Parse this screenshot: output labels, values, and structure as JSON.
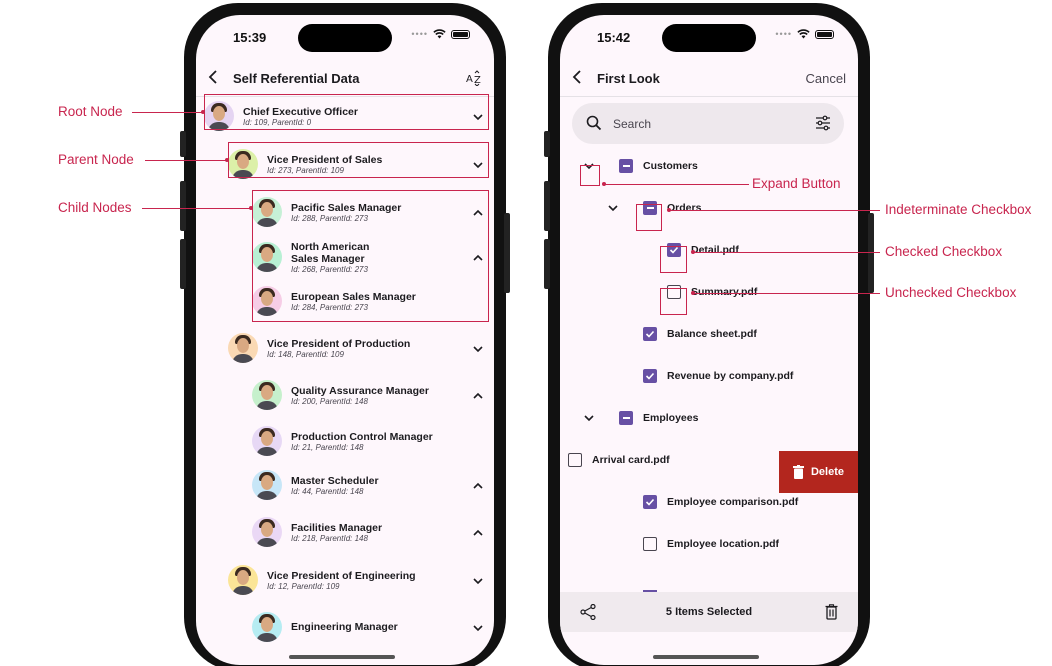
{
  "annotations": {
    "left": [
      "Root Node",
      "Parent Node",
      "Child Nodes"
    ],
    "right": [
      "Expand Button",
      "Indeterminate Checkbox",
      "Checked Checkbox",
      "Unchecked Checkbox"
    ],
    "accent": "#c8254e"
  },
  "left_phone": {
    "status_time": "15:39",
    "title": "Self Referential Data",
    "sort_icon_label": "AZ",
    "nodes": [
      {
        "title": "Chief Executive Officer",
        "sub": "Id: 109, ParentId: 0",
        "level": 0,
        "expander": "chevron-down",
        "avatar_bg": "#e5d4f2"
      },
      {
        "title": "Vice President of Sales",
        "sub": "Id: 273, ParentId: 109",
        "level": 1,
        "expander": "chevron-down",
        "avatar_bg": "#dcf0a8"
      },
      {
        "title": "Pacific Sales Manager",
        "sub": "Id: 288, ParentId: 273",
        "level": 2,
        "expander": "chevron-up",
        "avatar_bg": "#c6f0d6"
      },
      {
        "title": "North American Sales Manager",
        "title_line1": "North American",
        "title_line2": "Sales Manager",
        "sub": "Id: 268, ParentId: 273",
        "level": 2,
        "expander": "chevron-up",
        "avatar_bg": "#b8f0d4"
      },
      {
        "title": "European Sales Manager",
        "sub": "Id: 284, ParentId: 273",
        "level": 2,
        "expander": "none",
        "avatar_bg": "#f6cde6"
      },
      {
        "title": "Vice President of Production",
        "sub": "Id: 148, ParentId: 109",
        "level": 1,
        "expander": "chevron-down",
        "avatar_bg": "#fad9b4"
      },
      {
        "title": "Quality Assurance Manager",
        "sub": "Id: 200, ParentId: 148",
        "level": 2,
        "expander": "chevron-up",
        "avatar_bg": "#c6f0cc"
      },
      {
        "title": "Production Control Manager",
        "sub": "Id: 21, ParentId: 148",
        "level": 2,
        "expander": "none",
        "avatar_bg": "#e7d8f5"
      },
      {
        "title": "Master Scheduler",
        "sub": "Id: 44, ParentId: 148",
        "level": 2,
        "expander": "chevron-up",
        "avatar_bg": "#c7e6f7"
      },
      {
        "title": "Facilities Manager",
        "sub": "Id: 218, ParentId: 148",
        "level": 2,
        "expander": "chevron-up",
        "avatar_bg": "#ead8f5"
      },
      {
        "title": "Vice President of Engineering",
        "sub": "Id: 12, ParentId: 109",
        "level": 1,
        "expander": "chevron-down",
        "avatar_bg": "#fbe597"
      },
      {
        "title": "Engineering Manager",
        "sub": "",
        "level": 2,
        "expander": "chevron-down",
        "avatar_bg": "#b6ecf2"
      }
    ]
  },
  "right_phone": {
    "status_time": "15:42",
    "title": "First Look",
    "cancel_label": "Cancel",
    "search_placeholder": "Search",
    "rows": [
      {
        "label": "Customers",
        "level": 0,
        "state": "indeterminate",
        "expander": "chevron-down"
      },
      {
        "label": "Orders",
        "level": 1,
        "state": "indeterminate",
        "expander": "chevron-down"
      },
      {
        "label": "Detail.pdf",
        "level": 2,
        "state": "checked",
        "expander": "none"
      },
      {
        "label": "Summary.pdf",
        "level": 2,
        "state": "unchecked",
        "expander": "none"
      },
      {
        "label": "Balance sheet.pdf",
        "level": 1,
        "state": "checked",
        "expander": "none"
      },
      {
        "label": "Revenue by company.pdf",
        "level": 1,
        "state": "checked",
        "expander": "none"
      },
      {
        "label": "Employees",
        "level": 0,
        "state": "indeterminate",
        "expander": "chevron-down"
      },
      {
        "label": "Arrival card.pdf",
        "level": 1,
        "state": "unchecked",
        "expander": "none",
        "swiped": true
      },
      {
        "label": "Employee comparison.pdf",
        "level": 1,
        "state": "checked",
        "expander": "none"
      },
      {
        "label": "Employee location.pdf",
        "level": 1,
        "state": "unchecked",
        "expander": "none"
      }
    ],
    "swipe_action_label": "Delete",
    "swipe_action_color": "#b3261e",
    "checkbox_color": "#6750a4",
    "selection_text": "5 Items Selected"
  }
}
